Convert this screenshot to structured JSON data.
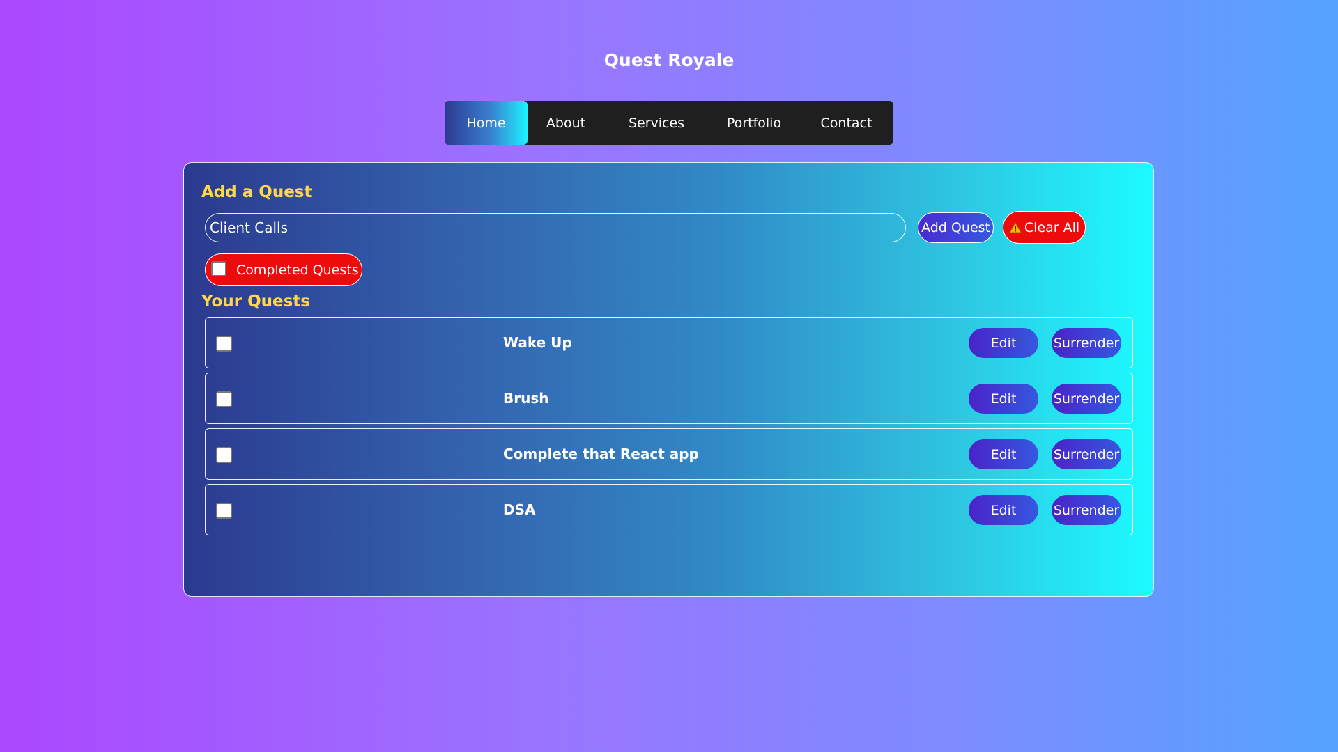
{
  "app": {
    "title": "Quest Royale"
  },
  "nav": {
    "items": [
      {
        "label": "Home",
        "active": true
      },
      {
        "label": "About",
        "active": false
      },
      {
        "label": "Services",
        "active": false
      },
      {
        "label": "Portfolio",
        "active": false
      },
      {
        "label": "Contact",
        "active": false
      }
    ]
  },
  "add_section": {
    "heading": "Add a Quest",
    "input_value": "Client Calls",
    "add_button": "Add Quest",
    "clear_button": "Clear All",
    "completed_toggle_label": "Completed Quests",
    "completed_toggle_checked": false
  },
  "quests_section": {
    "heading": "Your Quests",
    "quests": [
      {
        "title": "Wake Up",
        "checked": false,
        "edit_label": "Edit",
        "surrender_label": "Surrender"
      },
      {
        "title": "Brush",
        "checked": false,
        "edit_label": "Edit",
        "surrender_label": "Surrender"
      },
      {
        "title": "Complete that React app",
        "checked": false,
        "edit_label": "Edit",
        "surrender_label": "Surrender"
      },
      {
        "title": "DSA",
        "checked": false,
        "edit_label": "Edit",
        "surrender_label": "Surrender"
      }
    ]
  },
  "icons": {
    "clear_button_icon": "warning-icon"
  },
  "colors": {
    "heading_yellow": "#ffd84a",
    "danger_red": "#ee0b0b",
    "navbar_bg": "#1f1f1f"
  }
}
